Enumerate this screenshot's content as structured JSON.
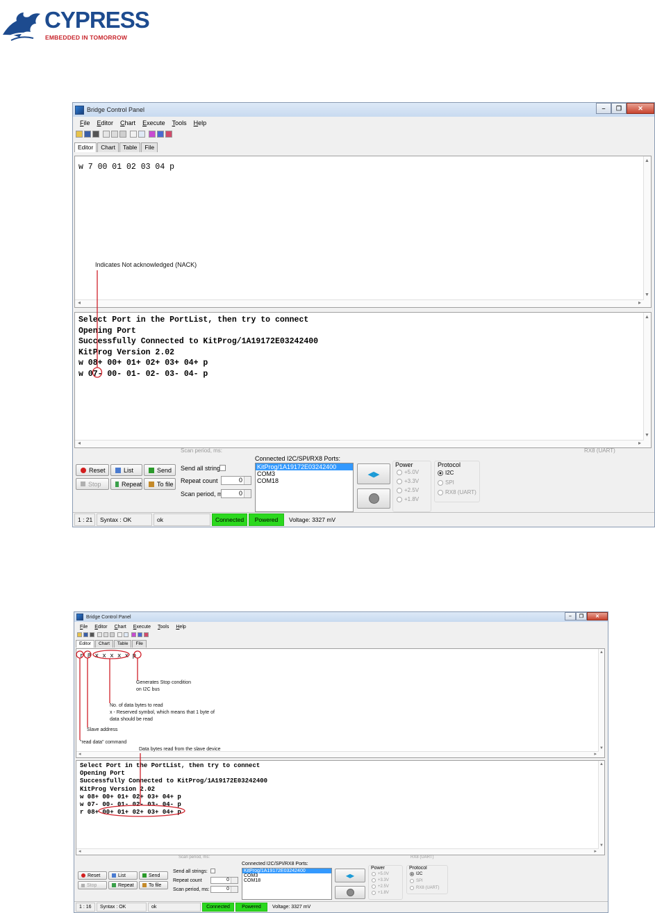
{
  "brand": {
    "name": "CYPRESS",
    "tagline": "EMBEDDED IN TOMORROW",
    "colors": {
      "primary": "#1d4b8f",
      "accent": "#c8252c"
    }
  },
  "window": {
    "title": "Bridge Control Panel",
    "menu": [
      "File",
      "Editor",
      "Chart",
      "Execute",
      "Tools",
      "Help"
    ],
    "tabs": [
      "Editor",
      "Chart",
      "Table",
      "File"
    ],
    "active_tab": "Editor",
    "buttons": {
      "reset": "Reset",
      "list": "List",
      "send": "Send",
      "stop": "Stop",
      "repeat": "Repeat",
      "to_file": "To file"
    },
    "send_all_strings_label": "Send all strings:",
    "repeat_count_label": "Repeat count",
    "repeat_count_value": "0",
    "scan_period_label": "Scan period, ms:",
    "scan_period_value": "0",
    "ports_label": "Connected I2C/SPI/RX8 Ports:",
    "ports": [
      "KitProg/1A19172E03242400",
      "COM3",
      "COM18"
    ],
    "selected_port": "KitProg/1A19172E03242400",
    "power_label": "Power",
    "power_options": [
      "+5.0V",
      "+3.3V",
      "+2.5V",
      "+1.8V"
    ],
    "protocol_label": "Protocol",
    "protocol_options": [
      "I2C",
      "SPI",
      "RX8 (UART)"
    ],
    "selected_protocol": "I2C",
    "ghost_scan_label": "Scan period, ms:",
    "ghost_rx8_label": "RX8 (UART)",
    "status": {
      "green_color": "#2bd81e",
      "voltage": "Voltage: 3327 mV",
      "connected": "Connected",
      "powered": "Powered",
      "syntax": "Syntax : OK"
    }
  },
  "screen1": {
    "editor_text": "w 7 00 01 02 03 04 p",
    "cursor_pos": "1 : 21",
    "status_msg": "ok",
    "log": [
      "Select Port in the PortList, then try to connect",
      "Opening Port",
      "Successfully Connected to KitProg/1A19172E03242400",
      "KitProg Version 2.02",
      "w 08+ 00+ 01+ 02+ 03+ 04+ p",
      "w 07- 00- 01- 02- 03- 04- p"
    ],
    "annotation": "Indicates Not acknowledged (NACK)"
  },
  "screen2": {
    "editor_text": "r 8 x x x x x p",
    "cursor_pos": "1 : 16",
    "status_msg": "ok",
    "log": [
      "Select Port in the PortList, then try to connect",
      "Opening Port",
      "Successfully Connected to KitProg/1A19172E03242400",
      "KitProg Version 2.02",
      "w 08+ 00+ 01+ 02+ 03+ 04+ p",
      "w 07- 00- 01- 02- 03- 04- p",
      "r 08+ 00+ 01+ 02+ 03+ 04+ p"
    ],
    "annotations": {
      "stop_1": "Generates Stop condition",
      "stop_2": "on I2C bus",
      "nbytes_1": "No. of data bytes to read",
      "nbytes_2": "x - Reserved symbol, which means that 1 byte of",
      "nbytes_3": "data should be read",
      "slave": "Slave address",
      "read_cmd": "\"read data\" command",
      "data_bytes": "Data bytes read from the slave device"
    }
  }
}
